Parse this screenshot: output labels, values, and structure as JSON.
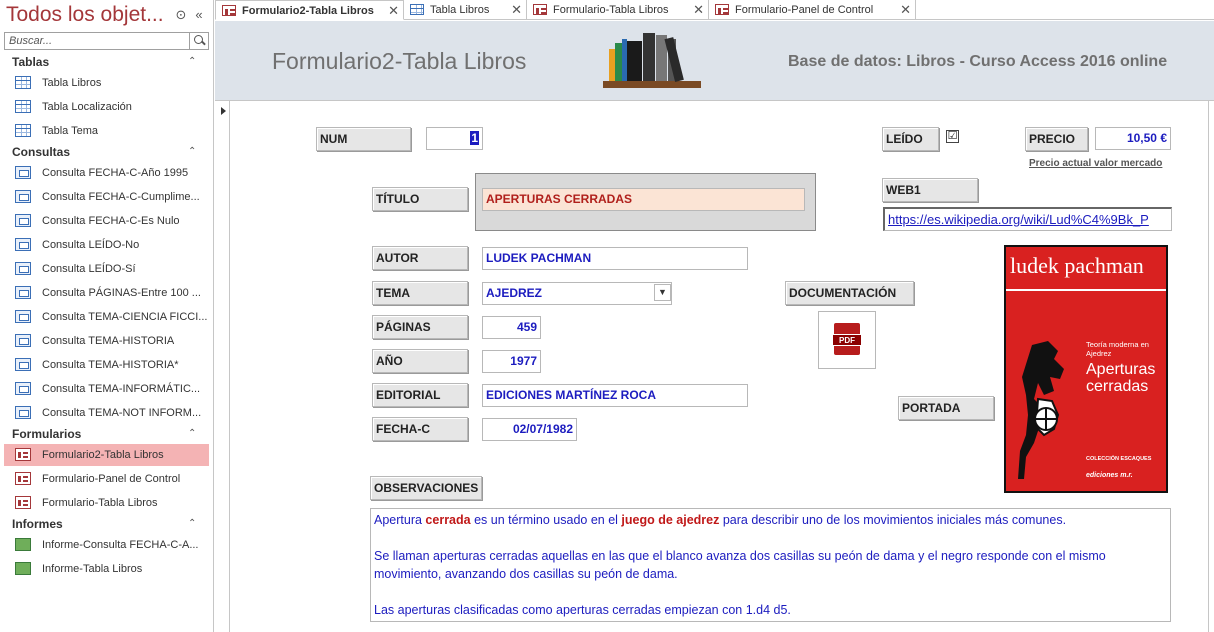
{
  "nav": {
    "title": "Todos los objet...",
    "search_placeholder": "Buscar...",
    "groups": [
      {
        "name": "Tablas",
        "items": [
          "Tabla Libros",
          "Tabla Localización",
          "Tabla Tema"
        ]
      },
      {
        "name": "Consultas",
        "items": [
          "Consulta FECHA-C-Año 1995",
          "Consulta FECHA-C-Cumplime...",
          "Consulta FECHA-C-Es Nulo",
          "Consulta LEÍDO-No",
          "Consulta LEÍDO-Sí",
          "Consulta PÁGINAS-Entre 100 ...",
          "Consulta TEMA-CIENCIA FICCI...",
          "Consulta TEMA-HISTORIA",
          "Consulta TEMA-HISTORIA*",
          "Consulta TEMA-INFORMÁTIC...",
          "Consulta TEMA-NOT INFORM..."
        ]
      },
      {
        "name": "Formularios",
        "items": [
          "Formulario2-Tabla Libros",
          "Formulario-Panel de Control",
          "Formulario-Tabla Libros"
        ]
      },
      {
        "name": "Informes",
        "items": [
          "Informe-Consulta FECHA-C-A...",
          "Informe-Tabla Libros"
        ]
      }
    ],
    "selected_item": "Formulario2-Tabla Libros"
  },
  "tabs": [
    "Formulario2-Tabla Libros",
    "Tabla Libros",
    "Formulario-Tabla Libros",
    "Formulario-Panel de Control"
  ],
  "header": {
    "title": "Formulario2-Tabla Libros",
    "database": "Base de datos: Libros - Curso Access 2016 online"
  },
  "form": {
    "num_label": "NUM",
    "num_value": "1",
    "leido_label": "LEÍDO",
    "leido_checked": "☑",
    "precio_label": "PRECIO",
    "precio_value": "10,50 €",
    "precio_note": "Precio actual valor mercado",
    "titulo_label": "TÍTULO",
    "titulo_value": "APERTURAS CERRADAS",
    "web_label": "WEB1",
    "web_value": "https://es.wikipedia.org/wiki/Lud%C4%9Bk_P",
    "autor_label": "AUTOR",
    "autor_value": "LUDEK PACHMAN",
    "tema_label": "TEMA",
    "tema_value": "AJEDREZ",
    "documentacion_label": "DOCUMENTACIÓN",
    "paginas_label": "PÁGINAS",
    "paginas_value": "459",
    "anio_label": "AÑO",
    "anio_value": "1977",
    "portada_label": "PORTADA",
    "editorial_label": "EDITORIAL",
    "editorial_value": "EDICIONES MARTÍNEZ ROCA",
    "fecha_label": "FECHA-C",
    "fecha_value": "02/07/1982",
    "obs_label": "OBSERVACIONES",
    "obs": {
      "p1_a": "Apertura ",
      "p1_b": "cerrada",
      "p1_c": " es un término usado en el ",
      "p1_d": "juego de ajedrez",
      "p1_e": " para describir uno de los movimientos iniciales más comunes.",
      "p2": "Se llaman aperturas cerradas aquellas en las que el blanco avanza dos casillas su peón de dama y el negro responde con el mismo movimiento, avanzando dos casillas su peón de dama.",
      "p3": "Las aperturas clasificadas como aperturas cerradas empiezan con 1.d4 d5."
    }
  },
  "cover": {
    "author": "ludek pachman",
    "subtitle": "Teoría moderna en Ajedrez",
    "title": "Aperturas cerradas",
    "collection": "COLECCIÓN ESCAQUES",
    "publisher": "ediciones m.r."
  },
  "pdf_icon_text": "PDF",
  "colors": {
    "accent": "#a4373a",
    "field_text": "#1c1cbf",
    "highlight": "#c01818",
    "cover": "#d92120",
    "header_bg": "#dde3ea"
  }
}
